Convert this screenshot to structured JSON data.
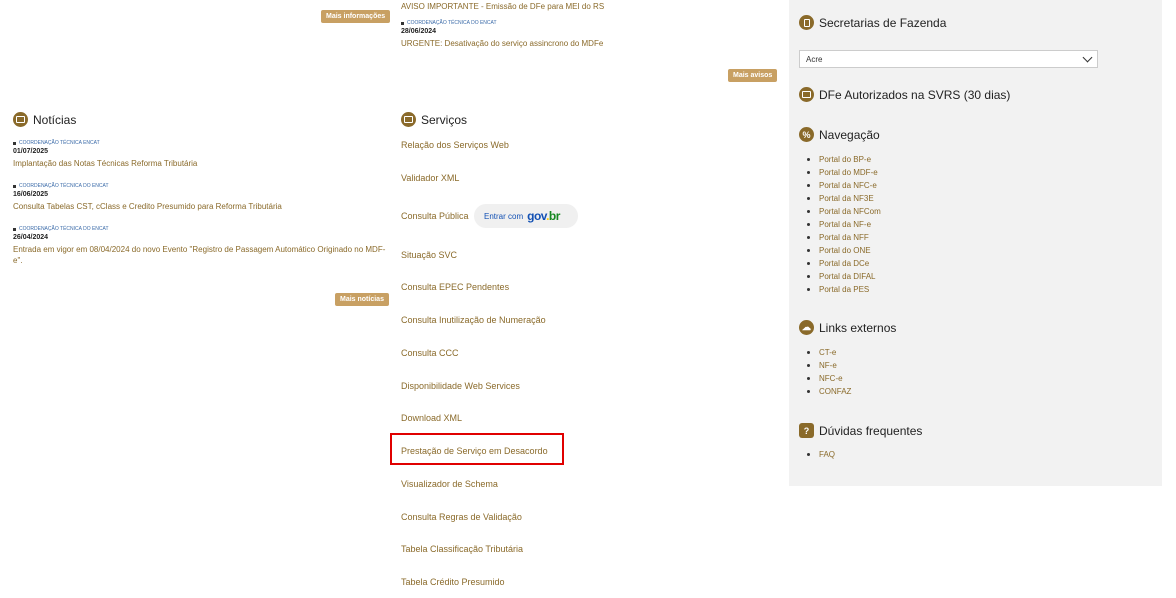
{
  "top_left": {
    "more_info_label": "Mais informações"
  },
  "top_middle": {
    "item1_title": "AVISO IMPORTANTE - Emissão de DFe para MEI do RS",
    "item2_category": "COORDENAÇÃO TÉCNICA DO ENCAT",
    "item2_date": "28/06/2024",
    "item2_title": "URGENTE: Desativação do serviço assincrono do MDFe",
    "more_label": "Mais avisos"
  },
  "noticias": {
    "title": "Notícias",
    "items": [
      {
        "category": "COORDENAÇÃO TÉCNICA ENCAT",
        "date": "01/07/2025",
        "title": "Implantação das Notas Técnicas Reforma Tributária"
      },
      {
        "category": "COORDENAÇÃO TÉCNICA DO ENCAT",
        "date": "16/06/2025",
        "title": "Consulta Tabelas CST, cClass e Credito Presumido para Reforma Tributária"
      },
      {
        "category": "COORDENAÇÃO TÉCNICA DO ENCAT",
        "date": "26/04/2024",
        "title": "Entrada em vigor em 08/04/2024 do novo Evento \"Registro de Passagem Automático Originado no MDF-e\"."
      }
    ],
    "more_label": "Mais notícias"
  },
  "servicos": {
    "title": "Serviços",
    "items": [
      "Relação dos Serviços Web",
      "Validador XML",
      "Consulta Pública",
      "Situação SVC",
      "Consulta EPEC Pendentes",
      "Consulta Inutilização de Numeração",
      "Consulta CCC",
      "Disponibilidade Web Services",
      "Download XML",
      "Prestação de Serviço em Desacordo",
      "Visualizador de Schema",
      "Consulta Regras de Validação",
      "Tabela Classificação Tributária",
      "Tabela Crédito Presumido"
    ],
    "govbr_label": "Entrar com",
    "govbr_logo": {
      "g": "gov",
      "dot": ".",
      "b": "br"
    }
  },
  "sidebar": {
    "secretarias_title": "Secretarias de Fazenda",
    "secretarias_selected": "Acre",
    "dfe_title": "DFe Autorizados na SVRS (30 dias)",
    "navegacao_title": "Navegação",
    "navegacao_items": [
      "Portal do BP-e",
      "Portal do MDF-e",
      "Portal da NFC-e",
      "Portal da NF3E",
      "Portal da NFCom",
      "Portal da NF-e",
      "Portal da NFF",
      "Portal do ONE",
      "Portal da DCe",
      "Portal da DIFAL",
      "Portal da PES"
    ],
    "links_title": "Links externos",
    "links_items": [
      "CT-e",
      "NF-e",
      "NFC-e",
      "CONFAZ"
    ],
    "duvidas_title": "Dúvidas frequentes",
    "duvidas_items": [
      "FAQ"
    ]
  },
  "colors": {
    "accent": "#8a6a2a",
    "button": "#c8a063",
    "highlight": "#e00000",
    "sidebar_bg": "#f2f2f2"
  }
}
